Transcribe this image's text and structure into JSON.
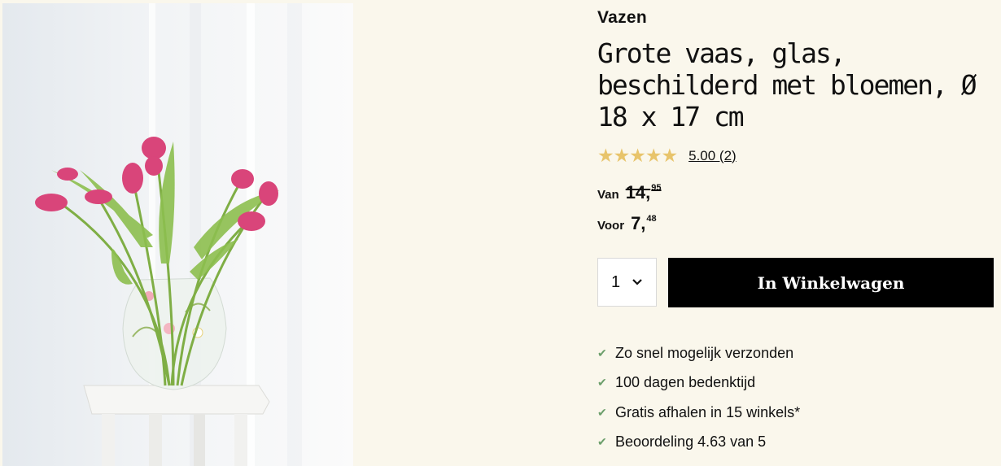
{
  "product": {
    "category": "Vazen",
    "title": "Grote vaas, glas, beschilderd met bloemen, Ø 18 x 17 cm",
    "image_alt": "Glazen vaas met roze tulpen op een witte kruk"
  },
  "rating": {
    "stars": "★★★★★",
    "value_label": "5.00 (2)",
    "star_color": "#e8c46b"
  },
  "price": {
    "old_label": "Van",
    "old_main": "14,",
    "old_cents": "95",
    "new_label": "Voor",
    "new_main": "7,",
    "new_cents": "48"
  },
  "quantity": {
    "value": "1"
  },
  "cart_button": {
    "label": "In Winkelwagen"
  },
  "usps": [
    "Zo snel mogelijk verzonden",
    "100 dagen bedenktijd",
    "Gratis afhalen in 15 winkels*",
    "Beoordeling 4.63 van 5"
  ],
  "colors": {
    "background": "#faf7ec",
    "button": "#000000",
    "check": "#6b9e6b"
  }
}
